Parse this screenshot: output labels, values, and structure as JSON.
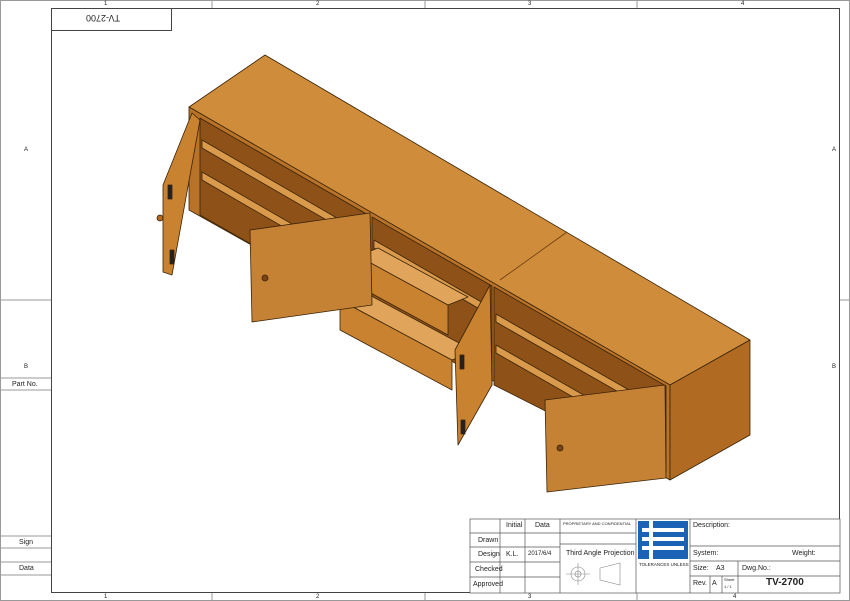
{
  "sheet": {
    "columns": [
      "1",
      "2",
      "3",
      "4"
    ],
    "rows": [
      "A",
      "B"
    ],
    "mirrored_title": "TV-2700"
  },
  "side_labels": {
    "part_no": "Part No.",
    "sign": "Sign",
    "data": "Data"
  },
  "title_block": {
    "initial_header": "Initial",
    "data_header": "Data",
    "rows": [
      {
        "label": "Drawn",
        "initial": "",
        "date": ""
      },
      {
        "label": "Design",
        "initial": "K.L.",
        "date": "2017/6/4"
      },
      {
        "label": "Checked",
        "initial": "",
        "date": ""
      },
      {
        "label": "Approved",
        "initial": "",
        "date": ""
      }
    ],
    "notice_title": "PROPRIETARY AND CONFIDENTIAL",
    "projection": "Third Angle Projection",
    "tolerances_title": "TOLERANCES UNLESS",
    "description_label": "Description:",
    "system_label": "System:",
    "weight_label": "Weight:",
    "size_label": "Size:",
    "size_value": "A3",
    "dwg_label": "Dwg.No.:",
    "rev_label": "Rev.",
    "rev_value": "A",
    "sheet_label": "Sheet",
    "sheet_value": "1 / 1",
    "dwg_no": "TV-2700"
  },
  "colors": {
    "wood_top": "#cf8c3a",
    "wood_front": "#c27a2c",
    "wood_side": "#b06a22",
    "wood_dark": "#8e5218",
    "logo_blue": "#1d63b5"
  }
}
